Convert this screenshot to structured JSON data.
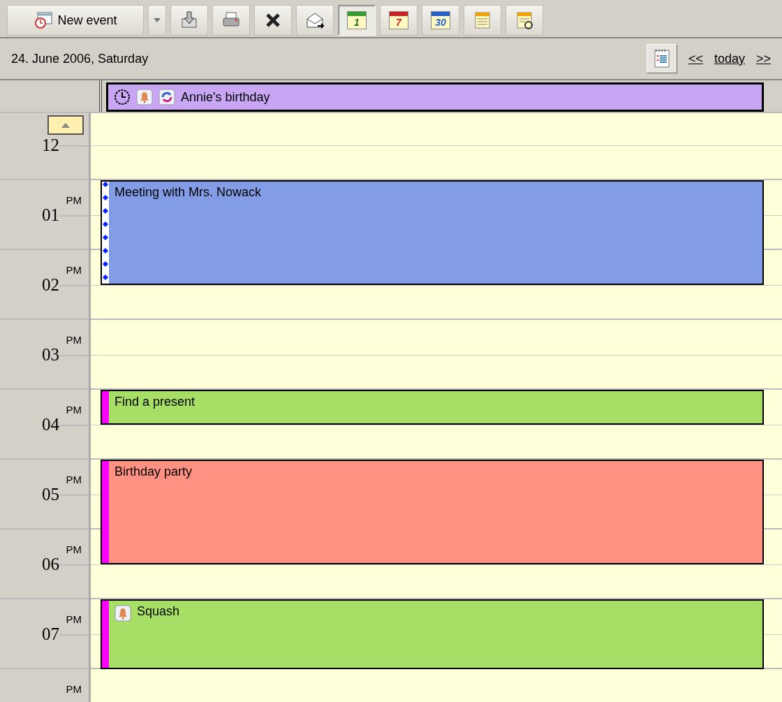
{
  "toolbar": {
    "new_event": {
      "label": "New event"
    },
    "buttons": [
      {
        "kind": "import",
        "selected": false
      },
      {
        "kind": "print",
        "selected": false
      },
      {
        "kind": "delete",
        "selected": false
      },
      {
        "kind": "mail",
        "selected": false
      },
      {
        "kind": "day",
        "label": "1",
        "selected": true
      },
      {
        "kind": "week",
        "label": "7",
        "selected": false
      },
      {
        "kind": "month",
        "label": "30",
        "selected": false
      },
      {
        "kind": "list",
        "selected": false
      },
      {
        "kind": "sync",
        "selected": false
      }
    ]
  },
  "header": {
    "date": "24. June 2006, Saturday",
    "prev": "<<",
    "today": "today",
    "next": ">>"
  },
  "all_day": [
    {
      "title": "Annie's birthday",
      "color": "#c8a6f4",
      "has_clock": true,
      "has_alarm": true,
      "recurring": true
    }
  ],
  "hours": [
    {
      "label": "12"
    },
    {
      "label": "01",
      "suffix": "PM",
      "events": [
        {
          "title": "Meeting with Mrs. Nowack",
          "color": "#829ce6",
          "kind": "tentative",
          "has_alarm": false,
          "spans_hour": true,
          "extra_half": true
        }
      ]
    },
    {
      "label": "02",
      "suffix": "PM"
    },
    {
      "label": "03",
      "suffix": "PM"
    },
    {
      "label": "04",
      "suffix": "PM",
      "events": [
        {
          "title": "Find a present",
          "color": "#a6de66",
          "kind": "busy",
          "has_alarm": false,
          "spans_hour": false,
          "extra_half": true
        }
      ]
    },
    {
      "label": "05",
      "suffix": "PM",
      "events": [
        {
          "title": "Birthday party",
          "color": "#ff9282",
          "kind": "busy",
          "has_alarm": false,
          "spans_hour": true,
          "extra_half": true
        }
      ]
    },
    {
      "label": "06",
      "suffix": "PM"
    },
    {
      "label": "07",
      "suffix": "PM",
      "events": [
        {
          "title": "Squash",
          "color": "#a6de66",
          "kind": "busy",
          "has_alarm": true,
          "spans_hour": true,
          "extra_half": false
        }
      ]
    },
    {
      "suffix": "PM"
    }
  ]
}
